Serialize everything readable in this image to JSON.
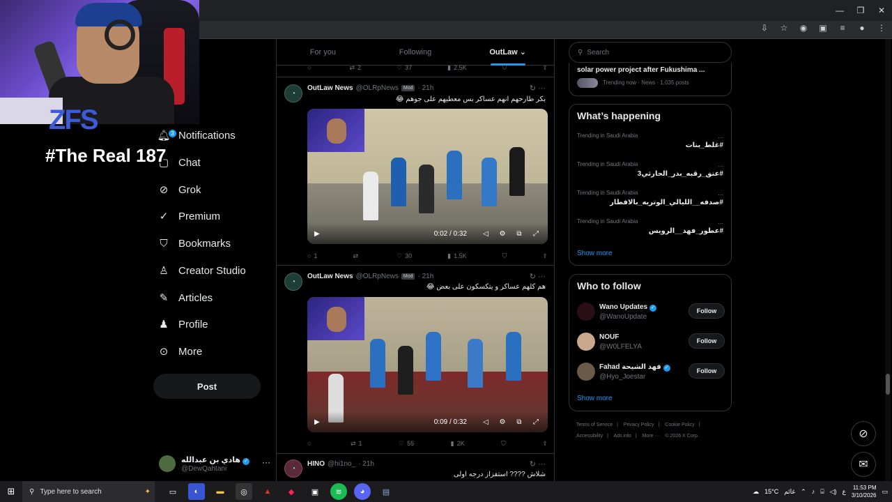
{
  "window": {
    "minimize": "—",
    "restore": "❐",
    "close": "✕"
  },
  "overlay": {
    "logo": "ZFS",
    "text": "#The Real 187"
  },
  "nav": {
    "partial_home": "ne",
    "partial_explore": "re",
    "items": [
      {
        "label": "Notifications",
        "badge": "3"
      },
      {
        "label": "Chat"
      },
      {
        "label": "Grok"
      },
      {
        "label": "Premium"
      },
      {
        "label": "Bookmarks"
      },
      {
        "label": "Creator Studio"
      },
      {
        "label": "Articles"
      },
      {
        "label": "Profile"
      },
      {
        "label": "More"
      }
    ],
    "post_button": "Post",
    "account": {
      "name": "هادي بن عبدالله",
      "handle": "@DewQahtani",
      "more": "···"
    }
  },
  "tabs": [
    {
      "label": "For you"
    },
    {
      "label": "Following"
    },
    {
      "label": "OutLaw ⌄"
    }
  ],
  "top_actions": {
    "replies": "",
    "reposts": "2",
    "likes": "37",
    "views": "2.5K"
  },
  "tweets": [
    {
      "name": "OutLaw News",
      "handle": "@OLRpNews",
      "mod": "Mod",
      "time": "· 21h",
      "text": "بكر طارحهم انهم عساكر بس معطيهم على جوهم 😂",
      "video_time": "0:02 / 0:32",
      "actions": {
        "replies": "1",
        "reposts": "",
        "likes": "30",
        "views": "1.5K"
      }
    },
    {
      "name": "OutLaw News",
      "handle": "@OLRpNews",
      "mod": "Mod",
      "time": "· 21h",
      "text": "هم كلهم عساكر و يتكسكون على بعض 😂",
      "video_time": "0:09 / 0:32",
      "actions": {
        "replies": "",
        "reposts": "1",
        "likes": "55",
        "views": "2K"
      }
    },
    {
      "name": "HINO",
      "handle": "@hi1no_",
      "time": "· 21h",
      "text": "شلاش ???? استفزاز درجه اولى"
    }
  ],
  "search": {
    "placeholder": "Search"
  },
  "news_card": {
    "headline": "solar power project after Fukushima ...",
    "meta": "Trending now · News · 1,035 posts"
  },
  "whats_happening": {
    "title": "What’s happening",
    "trends": [
      {
        "context": "Trending in Saudi Arabia",
        "name": "#غلط_بنات"
      },
      {
        "context": "Trending in Saudi Arabia",
        "name": "#عنق_رقبه_بدر_الحارثي3"
      },
      {
        "context": "Trending in Saudi Arabia",
        "name": "#صدفه__الليالي_الوتريه_بالافطار"
      },
      {
        "context": "Trending in Saudi Arabia",
        "name": "#عطور_فهد__الرويس"
      }
    ],
    "more_dots": "...",
    "show_more": "Show more"
  },
  "who_to_follow": {
    "title": "Who to follow",
    "users": [
      {
        "name": "Wano Updates",
        "handle": "@WanoUpdate",
        "verified": true,
        "follow": "Follow"
      },
      {
        "name": "NOUF",
        "handle": "@W0LFELYA",
        "verified": false,
        "follow": "Follow"
      },
      {
        "name": "Fahad فهد الشيحة",
        "handle": "@Hyo_Joestar",
        "verified": true,
        "follow": "Follow"
      }
    ],
    "show_more": "Show more"
  },
  "footer": {
    "terms": "Terms of Service",
    "privacy": "Privacy Policy",
    "cookie": "Cookie Policy",
    "accessibility": "Accessibility",
    "ads": "Ads info",
    "more": "More ···",
    "copyright": "© 2026 X Corp."
  },
  "taskbar": {
    "search_placeholder": "Type here to search",
    "weather": "15°C",
    "weather_label": "غائم",
    "lang": "ع",
    "time": "11:53 PM",
    "date": "3/10/2026"
  }
}
